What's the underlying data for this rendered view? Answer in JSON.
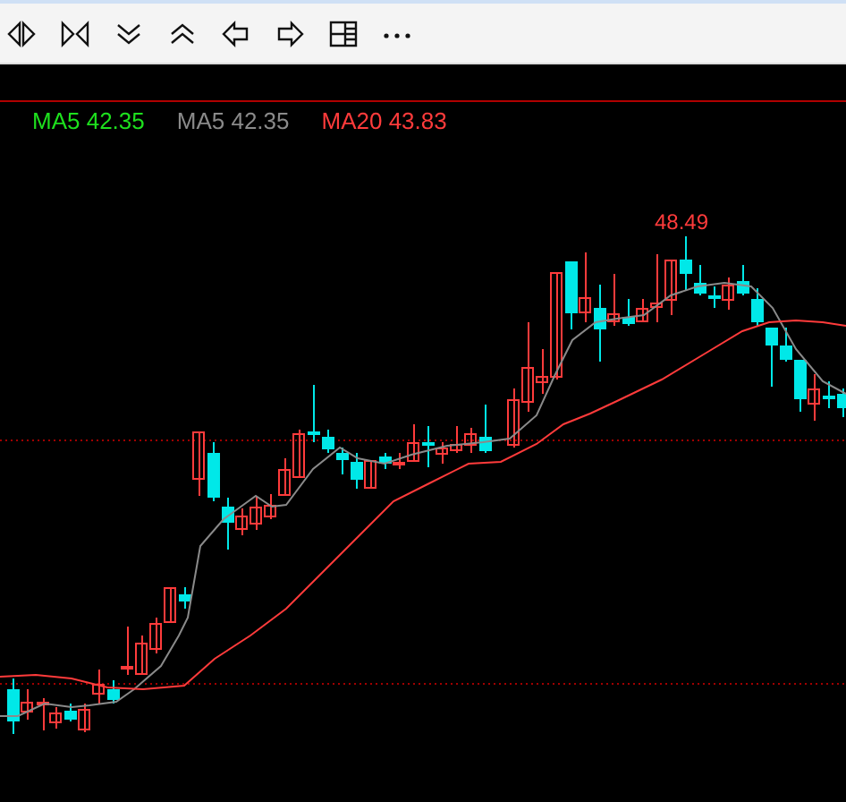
{
  "legend": [
    {
      "label": "MA5 42.35",
      "color": "#1ee01e"
    },
    {
      "label": "MA5 42.35",
      "color": "#8a8a8a"
    },
    {
      "label": "MA20 43.83",
      "color": "#ff3b3b"
    }
  ],
  "chart": {
    "high_label": "48.49"
  }
}
